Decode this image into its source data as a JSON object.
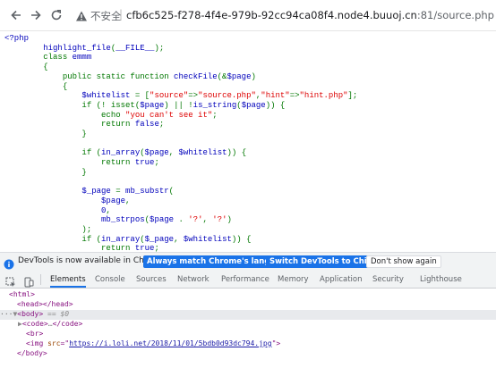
{
  "browser": {
    "security_label": "不安全",
    "url_host": "cfb6c525-f278-4f4e-979b-92cc94ca08f4.node4.buuoj.cn",
    "url_port_path": ":81/source.php",
    "back_icon": "back-arrow-icon",
    "forward_icon": "forward-arrow-icon",
    "reload_icon": "reload-icon",
    "warning_icon": "warning-triangle-icon"
  },
  "source": {
    "lines": [
      [
        {
          "t": "<?php",
          "c": "def"
        }
      ],
      [
        {
          "t": "        highlight_file",
          "c": "def"
        },
        {
          "t": "(",
          "c": "kw"
        },
        {
          "t": "__FILE__",
          "c": "def"
        },
        {
          "t": ");",
          "c": "kw"
        }
      ],
      [
        {
          "t": "        ",
          "c": "def"
        },
        {
          "t": "class ",
          "c": "kw"
        },
        {
          "t": "emmm",
          "c": "def"
        }
      ],
      [
        {
          "t": "        ",
          "c": "def"
        },
        {
          "t": "{",
          "c": "kw"
        }
      ],
      [
        {
          "t": "            ",
          "c": "def"
        },
        {
          "t": "public static function ",
          "c": "kw"
        },
        {
          "t": "checkFile",
          "c": "def"
        },
        {
          "t": "(&",
          "c": "kw"
        },
        {
          "t": "$page",
          "c": "def"
        },
        {
          "t": ")",
          "c": "kw"
        }
      ],
      [
        {
          "t": "            ",
          "c": "def"
        },
        {
          "t": "{",
          "c": "kw"
        }
      ],
      [
        {
          "t": "                ",
          "c": "def"
        },
        {
          "t": "$whitelist ",
          "c": "def"
        },
        {
          "t": "= [",
          "c": "kw"
        },
        {
          "t": "\"source\"",
          "c": "str"
        },
        {
          "t": "=>",
          "c": "kw"
        },
        {
          "t": "\"source.php\"",
          "c": "str"
        },
        {
          "t": ",",
          "c": "kw"
        },
        {
          "t": "\"hint\"",
          "c": "str"
        },
        {
          "t": "=>",
          "c": "kw"
        },
        {
          "t": "\"hint.php\"",
          "c": "str"
        },
        {
          "t": "];",
          "c": "kw"
        }
      ],
      [
        {
          "t": "                ",
          "c": "def"
        },
        {
          "t": "if (! ",
          "c": "kw"
        },
        {
          "t": "isset",
          "c": "kw"
        },
        {
          "t": "(",
          "c": "kw"
        },
        {
          "t": "$page",
          "c": "def"
        },
        {
          "t": ") || !",
          "c": "kw"
        },
        {
          "t": "is_string",
          "c": "def"
        },
        {
          "t": "(",
          "c": "kw"
        },
        {
          "t": "$page",
          "c": "def"
        },
        {
          "t": ")) {",
          "c": "kw"
        }
      ],
      [
        {
          "t": "                    ",
          "c": "def"
        },
        {
          "t": "echo ",
          "c": "kw"
        },
        {
          "t": "\"you can't see it\"",
          "c": "str"
        },
        {
          "t": ";",
          "c": "kw"
        }
      ],
      [
        {
          "t": "                    ",
          "c": "def"
        },
        {
          "t": "return ",
          "c": "kw"
        },
        {
          "t": "false",
          "c": "def"
        },
        {
          "t": ";",
          "c": "kw"
        }
      ],
      [
        {
          "t": "                ",
          "c": "def"
        },
        {
          "t": "}",
          "c": "kw"
        }
      ],
      [
        {
          "t": "",
          "c": "def"
        }
      ],
      [
        {
          "t": "                ",
          "c": "def"
        },
        {
          "t": "if (",
          "c": "kw"
        },
        {
          "t": "in_array",
          "c": "def"
        },
        {
          "t": "(",
          "c": "kw"
        },
        {
          "t": "$page",
          "c": "def"
        },
        {
          "t": ", ",
          "c": "kw"
        },
        {
          "t": "$whitelist",
          "c": "def"
        },
        {
          "t": ")) {",
          "c": "kw"
        }
      ],
      [
        {
          "t": "                    ",
          "c": "def"
        },
        {
          "t": "return ",
          "c": "kw"
        },
        {
          "t": "true",
          "c": "def"
        },
        {
          "t": ";",
          "c": "kw"
        }
      ],
      [
        {
          "t": "                ",
          "c": "def"
        },
        {
          "t": "}",
          "c": "kw"
        }
      ],
      [
        {
          "t": "",
          "c": "def"
        }
      ],
      [
        {
          "t": "                ",
          "c": "def"
        },
        {
          "t": "$_page ",
          "c": "def"
        },
        {
          "t": "= ",
          "c": "kw"
        },
        {
          "t": "mb_substr",
          "c": "def"
        },
        {
          "t": "(",
          "c": "kw"
        }
      ],
      [
        {
          "t": "                    $page",
          "c": "def"
        },
        {
          "t": ",",
          "c": "kw"
        }
      ],
      [
        {
          "t": "                    0",
          "c": "def"
        },
        {
          "t": ",",
          "c": "kw"
        }
      ],
      [
        {
          "t": "                    mb_strpos",
          "c": "def"
        },
        {
          "t": "(",
          "c": "kw"
        },
        {
          "t": "$page ",
          "c": "def"
        },
        {
          "t": ". ",
          "c": "kw"
        },
        {
          "t": "'?'",
          "c": "str"
        },
        {
          "t": ", ",
          "c": "kw"
        },
        {
          "t": "'?'",
          "c": "str"
        },
        {
          "t": ")",
          "c": "kw"
        }
      ],
      [
        {
          "t": "                ",
          "c": "def"
        },
        {
          "t": ");",
          "c": "kw"
        }
      ],
      [
        {
          "t": "                ",
          "c": "def"
        },
        {
          "t": "if (",
          "c": "kw"
        },
        {
          "t": "in_array",
          "c": "def"
        },
        {
          "t": "(",
          "c": "kw"
        },
        {
          "t": "$_page",
          "c": "def"
        },
        {
          "t": ", ",
          "c": "kw"
        },
        {
          "t": "$whitelist",
          "c": "def"
        },
        {
          "t": ")) {",
          "c": "kw"
        }
      ],
      [
        {
          "t": "                    ",
          "c": "def"
        },
        {
          "t": "return ",
          "c": "kw"
        },
        {
          "t": "true",
          "c": "def"
        },
        {
          "t": ";",
          "c": "kw"
        }
      ],
      [
        {
          "t": "                ",
          "c": "def"
        },
        {
          "t": "}",
          "c": "kw"
        }
      ]
    ]
  },
  "infobar": {
    "message": "DevTools is now available in Chinese!",
    "btn_match": "Always match Chrome's language",
    "btn_switch": "Switch DevTools to Chinese",
    "btn_dismiss": "Don't show again",
    "info_icon": "info-icon"
  },
  "devtools": {
    "inspect_icon": "inspect-element-icon",
    "device_icon": "device-toolbar-icon",
    "tabs": [
      "Elements",
      "Console",
      "Sources",
      "Network",
      "Performance",
      "Memory",
      "Application",
      "Security",
      "Lighthouse"
    ],
    "active_tab": "Elements",
    "dom": {
      "html_open": "<html>",
      "head": "<head></head>",
      "body_open": "<body>",
      "body_eq": " == ",
      "body_var": "$0",
      "code_open": "<code>",
      "code_ellipsis": "…",
      "code_close": "</code>",
      "br": "<br>",
      "img_open": "<img ",
      "img_attr": "src",
      "img_eq": "=\"",
      "img_src": "https://i.loli.net/2018/11/01/5bdb0d93dc794.jpg",
      "img_close": "\">",
      "body_close": "</body>"
    }
  }
}
